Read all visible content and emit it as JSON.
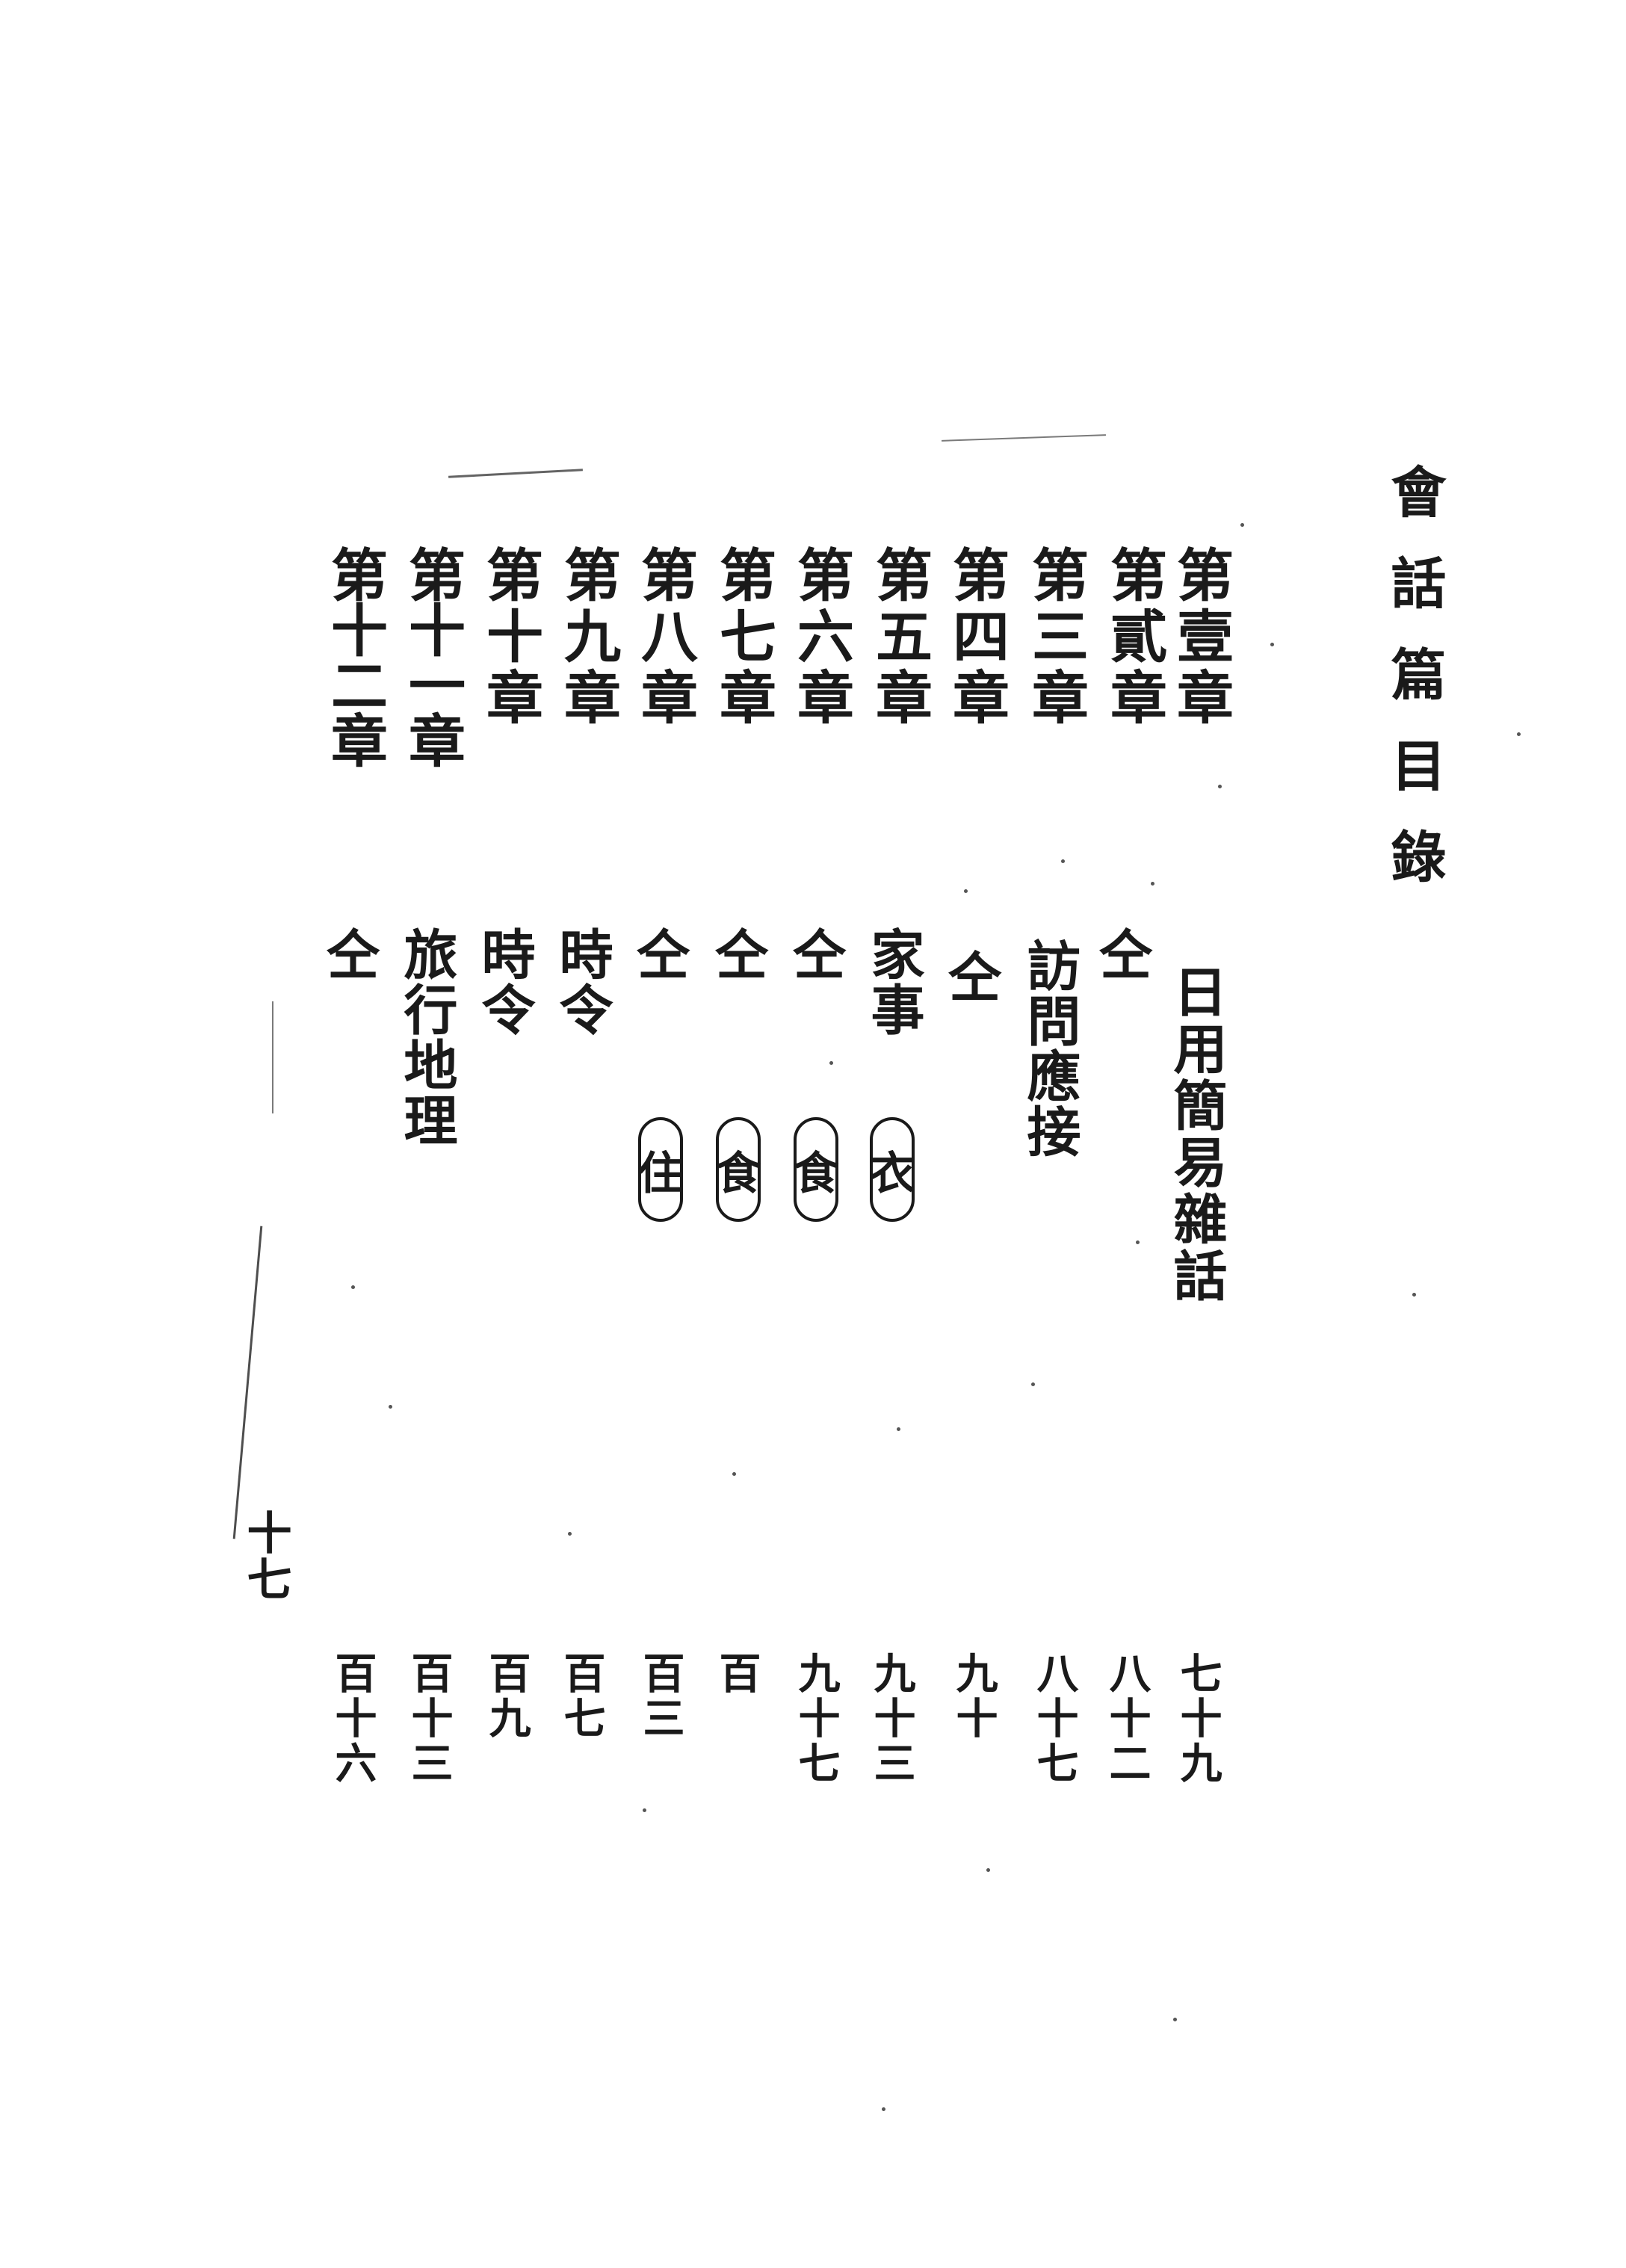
{
  "title": "會話篇目錄",
  "folio": "十七",
  "entries": [
    {
      "chapter": "第壹章",
      "subject": "日用簡易雜話",
      "page": "七十九"
    },
    {
      "chapter": "第貳章",
      "subject": "仝",
      "page": "八十二"
    },
    {
      "chapter": "第三章",
      "subject": "訪問應接",
      "page": "八十七"
    },
    {
      "chapter": "第四章",
      "subject": "仝",
      "page": "九十"
    },
    {
      "chapter": "第五章",
      "subject": "家事",
      "tag": "衣",
      "page": "九十三"
    },
    {
      "chapter": "第六章",
      "subject": "仝",
      "tag": "食",
      "page": "九十七"
    },
    {
      "chapter": "第七章",
      "subject": "仝",
      "tag": "食",
      "page": "百"
    },
    {
      "chapter": "第八章",
      "subject": "仝",
      "tag": "住",
      "page": "百三"
    },
    {
      "chapter": "第九章",
      "subject": "時令",
      "page": "百七"
    },
    {
      "chapter": "第十章",
      "subject": "時令",
      "page": "百九"
    },
    {
      "chapter": "第十一章",
      "subject": "旅行地理",
      "page": "百十三"
    },
    {
      "chapter": "第十二章",
      "subject": "仝",
      "page": "百十六"
    }
  ]
}
